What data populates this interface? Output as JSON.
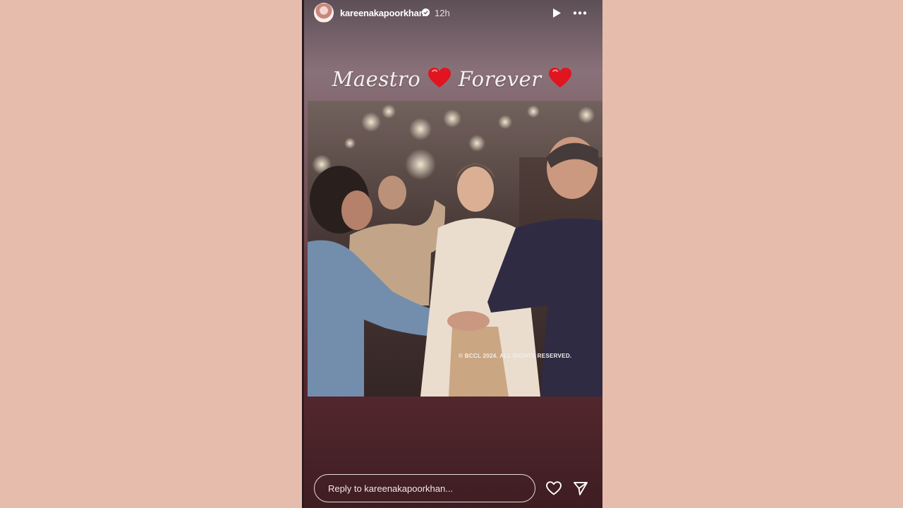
{
  "story": {
    "username": "kareenakapoorkhan",
    "time_ago": "12h",
    "verified": true,
    "caption_text_1": "Maestro",
    "caption_text_2": "Forever",
    "watermark": "© BCCL 2024. ALL RIGHTS RESERVED.",
    "reply_placeholder": "Reply to kareenakapoorkhan..."
  },
  "icons": {
    "avatar": "profile-avatar",
    "verified": "verified-badge-icon",
    "play": "play-icon",
    "more": "more-horizontal-icon",
    "heart_sticker": "red-heart-emoji",
    "like": "heart-outline-icon",
    "share": "send-icon"
  },
  "colors": {
    "page_background": "#e6bcad",
    "heart": "#e0151f"
  }
}
